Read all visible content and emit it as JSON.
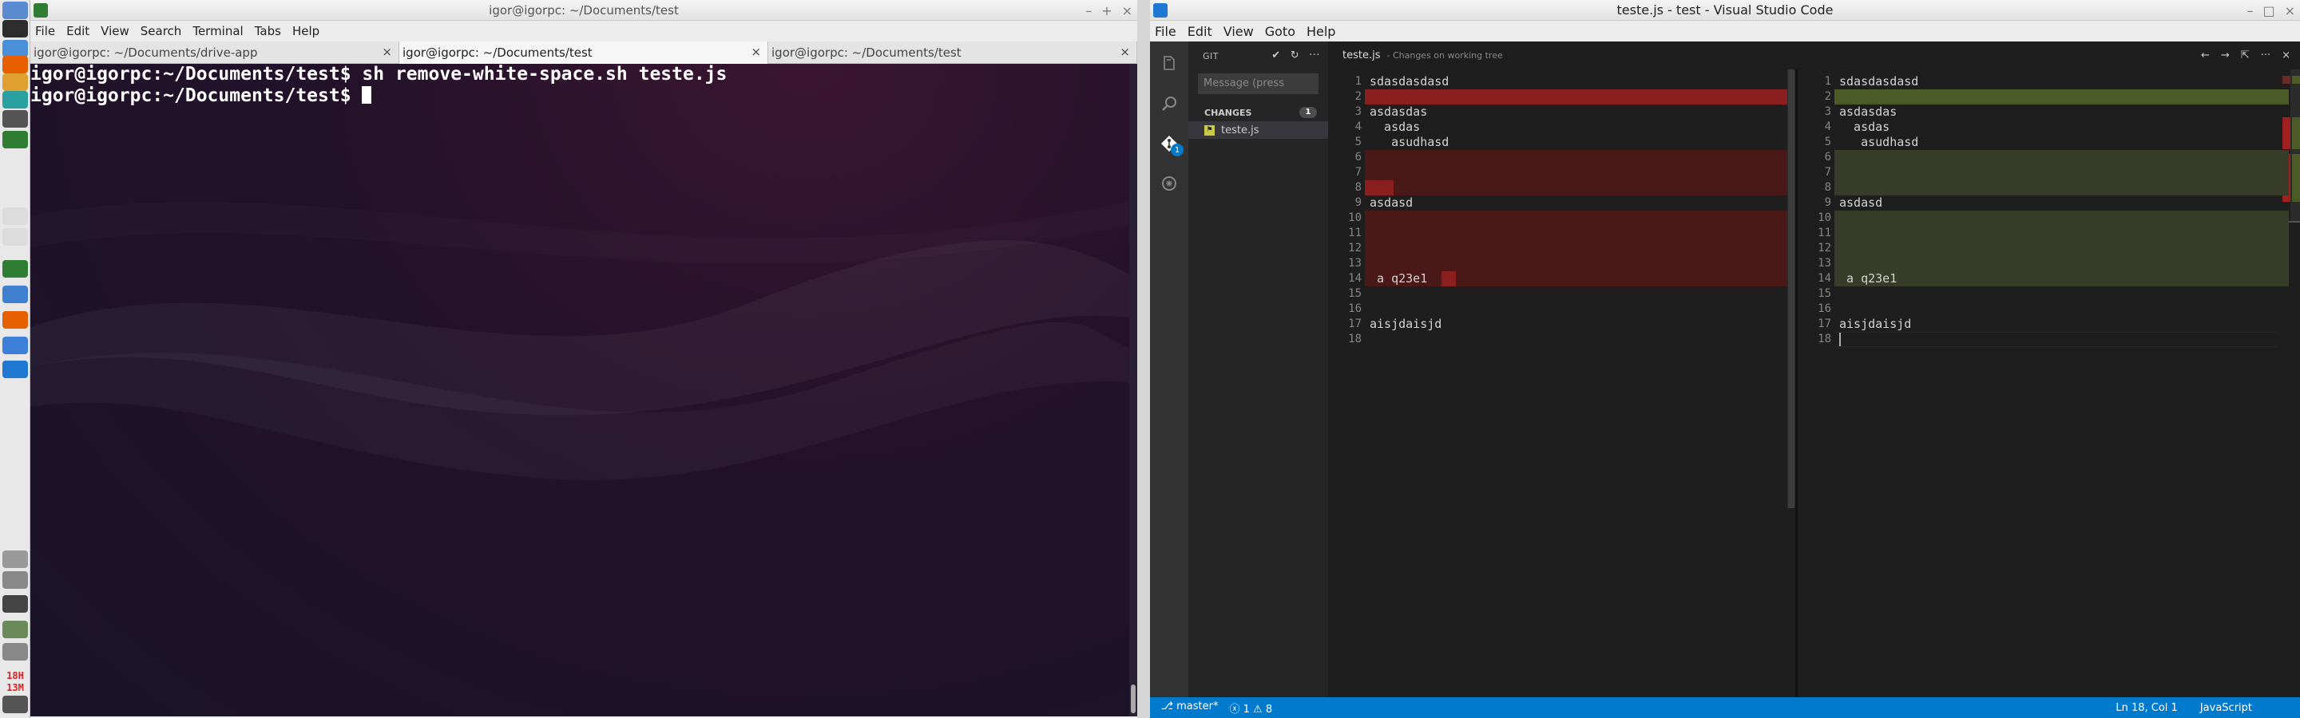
{
  "terminal": {
    "title": "igor@igorpc: ~/Documents/test",
    "menu": [
      "File",
      "Edit",
      "View",
      "Search",
      "Terminal",
      "Tabs",
      "Help"
    ],
    "tabs": [
      {
        "label": "igor@igorpc: ~/Documents/drive-app",
        "active": false
      },
      {
        "label": "igor@igorpc: ~/Documents/test",
        "active": true
      },
      {
        "label": "igor@igorpc: ~/Documents/test",
        "active": false
      }
    ],
    "lines": [
      "igor@igorpc:~/Documents/test$ sh remove-white-space.sh teste.js",
      "igor@igorpc:~/Documents/test$ "
    ]
  },
  "dock": {
    "icons": [
      {
        "name": "files-icon",
        "color": "#5a8ad0"
      },
      {
        "name": "terminal-icon",
        "color": "#2d2d2d"
      },
      {
        "name": "chromium-icon",
        "color": "#4a90d9"
      },
      {
        "name": "firefox-icon",
        "color": "#e66000"
      },
      {
        "name": "folder-icon",
        "color": "#e0a030"
      },
      {
        "name": "monitor-icon",
        "color": "#2aa0a0"
      },
      {
        "name": "sublime-icon",
        "color": "#555555"
      },
      {
        "name": "terminal-green-icon",
        "color": "#2e7d32"
      },
      {
        "name": "workspace-1-icon",
        "color": "#dcdcdc"
      },
      {
        "name": "workspace-2-icon",
        "color": "#dcdcdc"
      },
      {
        "name": "terminal-small-icon",
        "color": "#2e7d32"
      },
      {
        "name": "photos-icon",
        "color": "#3f7fd0"
      },
      {
        "name": "firefox-small-icon",
        "color": "#e66000"
      },
      {
        "name": "folder-blue-icon",
        "color": "#3d7ed8"
      },
      {
        "name": "vscode-icon",
        "color": "#1f78d1"
      },
      {
        "name": "volume-icon",
        "color": "#999999"
      },
      {
        "name": "keyboard-icon",
        "color": "#888888"
      },
      {
        "name": "network-icon",
        "color": "#444444"
      },
      {
        "name": "users-icon",
        "color": "#6a8a5a"
      },
      {
        "name": "battery-icon",
        "color": "#888888"
      },
      {
        "name": "power-icon",
        "color": "#555555"
      }
    ],
    "clock_hours": "18H",
    "clock_minutes": "13M"
  },
  "vscode": {
    "title": "teste.js - test - Visual Studio Code",
    "menu": [
      "File",
      "Edit",
      "View",
      "Goto",
      "Help"
    ],
    "git_panel": {
      "header": "GIT",
      "message_placeholder": "Message (press",
      "changes_label": "CHANGES",
      "changes_count": "1",
      "file": "teste.js",
      "badge": "1"
    },
    "editor_tab": {
      "file": "teste.js",
      "description": "- Changes on working tree"
    },
    "diff_left": [
      {
        "n": "1",
        "text": "sdasdasdasd",
        "hl": ""
      },
      {
        "n": "2",
        "text": "",
        "hl": "del-strong"
      },
      {
        "n": "3",
        "text": "asdasdas",
        "hl": ""
      },
      {
        "n": "4",
        "text": "  asdas",
        "hl": ""
      },
      {
        "n": "5",
        "text": "   asudhasd",
        "hl": ""
      },
      {
        "n": "6",
        "text": "",
        "hl": "del"
      },
      {
        "n": "7",
        "text": "",
        "hl": "del"
      },
      {
        "n": "8",
        "text": "",
        "hl": "del-part"
      },
      {
        "n": "9",
        "text": "asdasd",
        "hl": ""
      },
      {
        "n": "10",
        "text": "",
        "hl": "del"
      },
      {
        "n": "11",
        "text": "",
        "hl": "del"
      },
      {
        "n": "12",
        "text": "",
        "hl": "del"
      },
      {
        "n": "13",
        "text": "",
        "hl": "del"
      },
      {
        "n": "14",
        "text": " a q23e1",
        "hl": "del-tail"
      },
      {
        "n": "15",
        "text": "",
        "hl": ""
      },
      {
        "n": "16",
        "text": "",
        "hl": ""
      },
      {
        "n": "17",
        "text": "aisjdaisjd",
        "hl": ""
      },
      {
        "n": "18",
        "text": "",
        "hl": ""
      }
    ],
    "diff_right": [
      {
        "n": "1",
        "text": "sdasdasdasd",
        "hl": ""
      },
      {
        "n": "2",
        "text": "",
        "hl": "ins"
      },
      {
        "n": "3",
        "text": "asdasdas",
        "hl": ""
      },
      {
        "n": "4",
        "text": "  asdas",
        "hl": ""
      },
      {
        "n": "5",
        "text": "   asudhasd",
        "hl": ""
      },
      {
        "n": "6",
        "text": "",
        "hl": "ins"
      },
      {
        "n": "7",
        "text": "",
        "hl": "ins"
      },
      {
        "n": "8",
        "text": "",
        "hl": "ins"
      },
      {
        "n": "9",
        "text": "asdasd",
        "hl": ""
      },
      {
        "n": "10",
        "text": "",
        "hl": "ins"
      },
      {
        "n": "11",
        "text": "",
        "hl": "ins"
      },
      {
        "n": "12",
        "text": "",
        "hl": "ins"
      },
      {
        "n": "13",
        "text": "",
        "hl": "ins"
      },
      {
        "n": "14",
        "text": " a q23e1",
        "hl": "ins"
      },
      {
        "n": "15",
        "text": "",
        "hl": ""
      },
      {
        "n": "16",
        "text": "",
        "hl": ""
      },
      {
        "n": "17",
        "text": "aisjdaisjd",
        "hl": ""
      },
      {
        "n": "18",
        "text": "",
        "hl": "cursor"
      }
    ],
    "status": {
      "branch": "master*",
      "errors": "1",
      "warnings": "8",
      "position": "Ln 18, Col 1",
      "language": "JavaScript"
    }
  }
}
